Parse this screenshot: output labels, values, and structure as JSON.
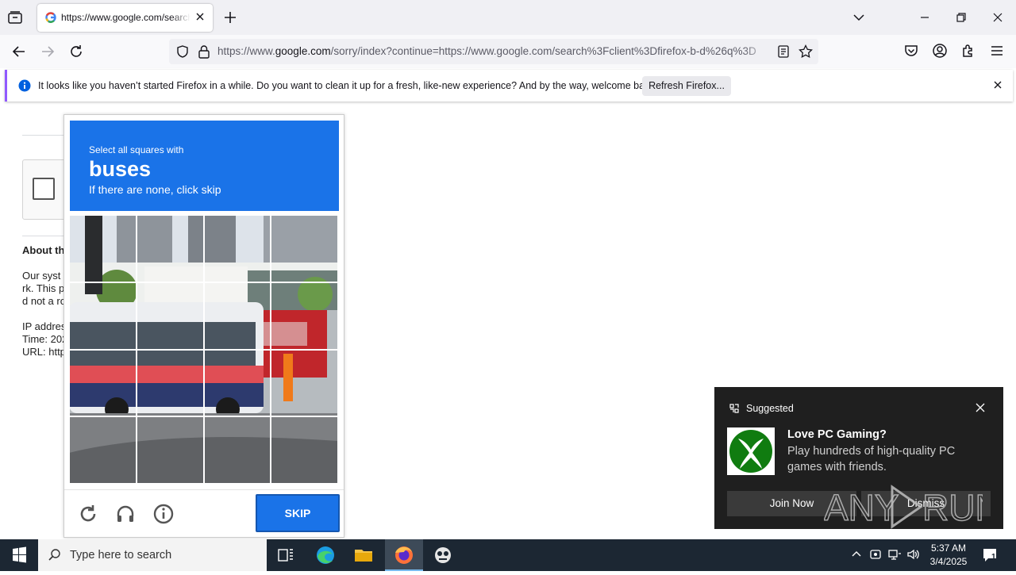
{
  "browser": {
    "tab": {
      "title": "https://www.google.com/search?client=firefox-b-d&q="
    },
    "url": {
      "domain_prefix": "https://www.",
      "domain": "google.com",
      "rest": "/sorry/index?continue=https://www.google.com/search%3Fclient%3Dfirefox-b-d%26q%3D"
    }
  },
  "notice": {
    "message": "It looks like you haven’t started Firefox in a while. Do you want to clean it up for a fresh, like-new experience? And by the way, welcome back!",
    "refresh_label": "Refresh Firefox..."
  },
  "page": {
    "about_heading": "About th",
    "lines": [
      "Our syst",
      "rk. This p",
      "d not a ro",
      "IP addres",
      "Time: 202",
      "URL: http"
    ]
  },
  "captcha": {
    "instruction_small": "Select all squares with",
    "target": "buses",
    "hint": "If there are none, click skip",
    "skip_label": "SKIP",
    "icons": [
      "reload-icon",
      "headphones-icon",
      "info-icon"
    ]
  },
  "toast": {
    "header": "Suggested",
    "title": "Love PC Gaming?",
    "body": "Play hundreds of high-quality PC games with friends.",
    "primary_label": "Join Now",
    "secondary_label": "Dismiss",
    "accent": "#107c10"
  },
  "taskbar": {
    "search_placeholder": "Type here to search",
    "time": "5:37 AM",
    "date": "3/4/2025",
    "notification_count": "1"
  },
  "watermark": {
    "text": "ANY RUN"
  }
}
